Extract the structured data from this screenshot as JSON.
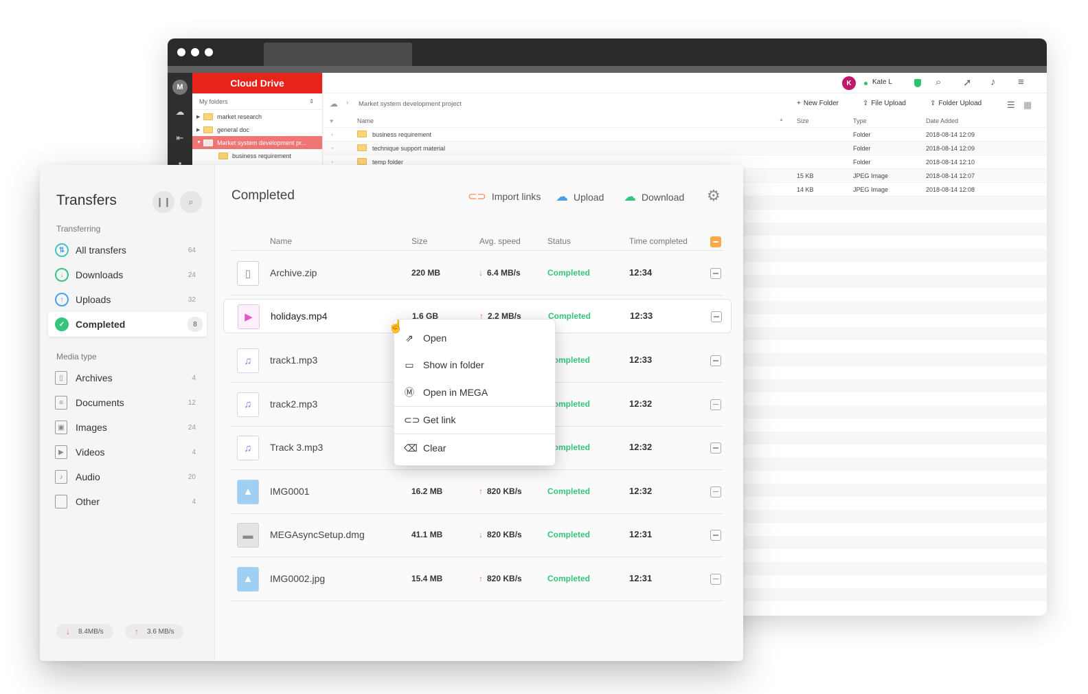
{
  "browser": {
    "cloud_drive": {
      "title": "Cloud Drive",
      "my_folders": "My folders",
      "tree": [
        {
          "label": "market research"
        },
        {
          "label": "general doc"
        },
        {
          "label": "Market system development pr..."
        },
        {
          "label": "business requirement"
        }
      ]
    },
    "user": {
      "initial": "K",
      "name": "Kate L"
    },
    "breadcrumb": "Market system development project",
    "actions": {
      "new_folder": "New Folder",
      "file_upload": "File Upload",
      "folder_upload": "Folder Upload"
    },
    "columns": {
      "name": "Name",
      "size": "Size",
      "type": "Type",
      "date": "Date Added"
    },
    "rows": [
      {
        "name": "business requirement",
        "size": "",
        "type": "Folder",
        "date": "2018-08-14 12:09"
      },
      {
        "name": "technique support material",
        "size": "",
        "type": "Folder",
        "date": "2018-08-14 12:09"
      },
      {
        "name": "temp folder",
        "size": "",
        "type": "Folder",
        "date": "2018-08-14 12:10"
      },
      {
        "name": "",
        "size": "15 KB",
        "type": "JPEG Image",
        "date": "2018-08-14 12:07"
      },
      {
        "name": "",
        "size": "14 KB",
        "type": "JPEG Image",
        "date": "2018-08-14 12:08"
      }
    ]
  },
  "transfers": {
    "title": "Transfers",
    "section_transferring": "Transferring",
    "nav": [
      {
        "label": "All transfers",
        "count": "64"
      },
      {
        "label": "Downloads",
        "count": "24"
      },
      {
        "label": "Uploads",
        "count": "32"
      },
      {
        "label": "Completed",
        "count": "8"
      }
    ],
    "section_media": "Media type",
    "media": [
      {
        "label": "Archives",
        "count": "4"
      },
      {
        "label": "Documents",
        "count": "12"
      },
      {
        "label": "Images",
        "count": "24"
      },
      {
        "label": "Videos",
        "count": "4"
      },
      {
        "label": "Audio",
        "count": "20"
      },
      {
        "label": "Other",
        "count": "4"
      }
    ],
    "down_speed": "8.4MB/s",
    "up_speed": "3.6 MB/s",
    "main": {
      "title": "Completed",
      "import_links": "Import links",
      "upload": "Upload",
      "download": "Download",
      "columns": {
        "name": "Name",
        "size": "Size",
        "speed": "Avg. speed",
        "status": "Status",
        "time": "Time completed"
      },
      "rows": [
        {
          "name": "Archive.zip",
          "size": "220 MB",
          "dir": "down",
          "speed": "6.4 MB/s",
          "status": "Completed",
          "time": "12:34",
          "kind": "zip"
        },
        {
          "name": "holidays.mp4",
          "size": "1.6 GB",
          "dir": "up",
          "speed": "2.2 MB/s",
          "status": "Completed",
          "time": "12:33",
          "kind": "video"
        },
        {
          "name": "track1.mp3",
          "size": "",
          "dir": "",
          "speed": "",
          "status": "Completed",
          "time": "12:33",
          "kind": "audio"
        },
        {
          "name": "track2.mp3",
          "size": "",
          "dir": "",
          "speed": "",
          "status": "Completed",
          "time": "12:32",
          "kind": "audio"
        },
        {
          "name": "Track 3.mp3",
          "size": "",
          "dir": "",
          "speed": "",
          "status": "Completed",
          "time": "12:32",
          "kind": "audio"
        },
        {
          "name": "IMG0001",
          "size": "16.2 MB",
          "dir": "up",
          "speed": "820 KB/s",
          "status": "Completed",
          "time": "12:32",
          "kind": "image"
        },
        {
          "name": "MEGAsyncSetup.dmg",
          "size": "41.1 MB",
          "dir": "down",
          "speed": "820 KB/s",
          "status": "Completed",
          "time": "12:31",
          "kind": "dmg"
        },
        {
          "name": "IMG0002.jpg",
          "size": "15.4 MB",
          "dir": "up",
          "speed": "820 KB/s",
          "status": "Completed",
          "time": "12:31",
          "kind": "image"
        }
      ]
    },
    "context_menu": [
      {
        "label": "Open",
        "icon": "external-link-icon"
      },
      {
        "label": "Show in folder",
        "icon": "folder-icon"
      },
      {
        "label": "Open in MEGA",
        "icon": "mega-icon"
      },
      {
        "label": "Get link",
        "icon": "link-icon"
      },
      {
        "label": "Clear",
        "icon": "eraser-icon"
      }
    ]
  },
  "colors": {
    "accent_red": "#e8231a",
    "completed_green": "#35c47a",
    "arrow_red": "#f06c5a",
    "checkbox_orange": "#f7a94b"
  }
}
